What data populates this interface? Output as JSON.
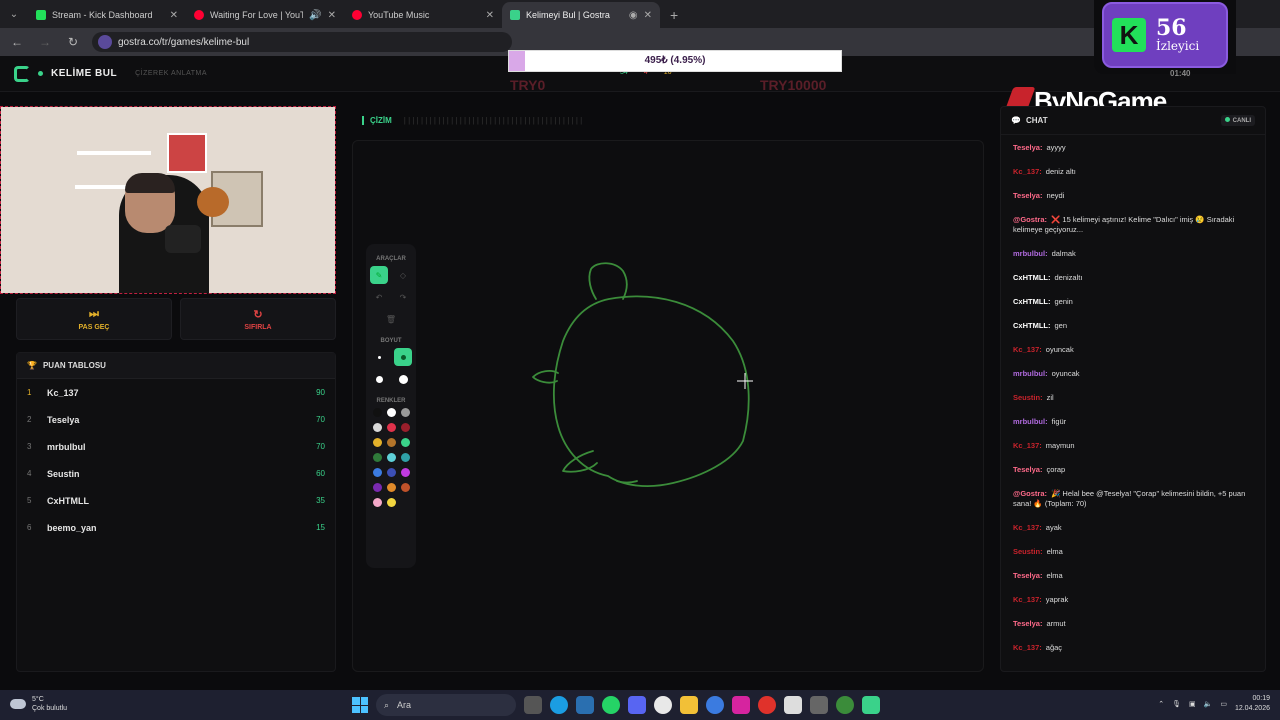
{
  "browser": {
    "tabs": [
      {
        "title": "Stream - Kick Dashboard",
        "color": "#22e05a"
      },
      {
        "title": "Waiting For Love | YouTube Mu",
        "color": "#ff0033"
      },
      {
        "title": "YouTube Music",
        "color": "#ff0033"
      },
      {
        "title": "Kelimeyi Bul | Gostra",
        "color": "#3ad28a"
      }
    ],
    "url": "gostra.co/tr/games/kelime-bul"
  },
  "site": {
    "name": "KELİME BUL",
    "subtitle": "ÇİZEREK ANLATMA"
  },
  "donation": {
    "progress_text": "495₺ (4.95%)",
    "progress_fraction": 0.0495,
    "left_label": "TRY0",
    "right_label": "TRY10000"
  },
  "stats": {
    "a": "34",
    "b": "4",
    "c": "16",
    "timer": "01:40"
  },
  "kick": {
    "letter": "K",
    "count": "56",
    "label": "İzleyici"
  },
  "sponsor": "ByNoGame",
  "controls": {
    "skip": "PAS GEÇ",
    "reset": "SIFIRLA"
  },
  "leaderboard": {
    "title": "PUAN TABLOSU",
    "rows": [
      {
        "rank": "1",
        "name": "Kc_137",
        "points": "90"
      },
      {
        "rank": "2",
        "name": "Teselya",
        "points": "70"
      },
      {
        "rank": "3",
        "name": "mrbulbul",
        "points": "70"
      },
      {
        "rank": "4",
        "name": "Seustin",
        "points": "60"
      },
      {
        "rank": "5",
        "name": "CxHTMLL",
        "points": "35"
      },
      {
        "rank": "6",
        "name": "beemo_yan",
        "points": "15"
      }
    ]
  },
  "canvas": {
    "title": "ÇİZİM"
  },
  "tools": {
    "tools_label": "ARAÇLAR",
    "size_label": "BOYUT",
    "colors_label": "RENKLER",
    "palette": [
      "#111111",
      "#ffffff",
      "#9a9a9a",
      "#d9d9d9",
      "#e0324b",
      "#9a1f2b",
      "#e2b02a",
      "#b3742a",
      "#3ad28a",
      "#2f7a3a",
      "#5fd0d8",
      "#2fa0a8",
      "#3b7be0",
      "#3c4fb5",
      "#c03ae0",
      "#7a2ab0",
      "#e08a2a",
      "#c0522a",
      "#f4a8c8",
      "#f2d640"
    ]
  },
  "chat": {
    "title": "CHAT",
    "live_label": "CANLI",
    "messages": [
      {
        "user": "Teselya:",
        "text": "ayyyy",
        "color": "#ff6a8a"
      },
      {
        "user": "Kc_137:",
        "text": "deniz altı",
        "color": "#c8232c"
      },
      {
        "user": "Teselya:",
        "text": "neydi",
        "color": "#ff6a8a"
      },
      {
        "user": "@Gostra:",
        "text": "❌ 15 kelimeyi aştınız! Kelime \"Dalıcı\" imiş 😢 Sıradaki kelimeye geçiyoruz...",
        "color": "#ff6a8a"
      },
      {
        "user": "mrbulbul:",
        "text": "dalmak",
        "color": "#b06adf"
      },
      {
        "user": "CxHTMLL:",
        "text": "denizaltı",
        "color": "#ffffff"
      },
      {
        "user": "CxHTMLL:",
        "text": "genin",
        "color": "#ffffff"
      },
      {
        "user": "CxHTMLL:",
        "text": "gen",
        "color": "#ffffff"
      },
      {
        "user": "Kc_137:",
        "text": "oyuncak",
        "color": "#c8232c"
      },
      {
        "user": "mrbulbul:",
        "text": "oyuncak",
        "color": "#b06adf"
      },
      {
        "user": "Seustin:",
        "text": "zil",
        "color": "#c8232c"
      },
      {
        "user": "mrbulbul:",
        "text": "figür",
        "color": "#b06adf"
      },
      {
        "user": "Kc_137:",
        "text": "maymun",
        "color": "#c8232c"
      },
      {
        "user": "Teselya:",
        "text": "çorap",
        "color": "#ff6a8a"
      },
      {
        "user": "@Gostra:",
        "text": "🎉 Helal bee @Teselya! \"Çorap\" kelimesini bildin, +5 puan sana! 🔥 (Toplam: 70)",
        "color": "#ff6a8a"
      },
      {
        "user": "Kc_137:",
        "text": "ayak",
        "color": "#c8232c"
      },
      {
        "user": "Seustin:",
        "text": "elma",
        "color": "#c8232c"
      },
      {
        "user": "Teselya:",
        "text": "elma",
        "color": "#ff6a8a"
      },
      {
        "user": "Kc_137:",
        "text": "yaprak",
        "color": "#c8232c"
      },
      {
        "user": "Teselya:",
        "text": "armut",
        "color": "#ff6a8a"
      },
      {
        "user": "Kc_137:",
        "text": "ağaç",
        "color": "#c8232c"
      }
    ]
  },
  "taskbar": {
    "temperature": "5°C",
    "weather": "Çok bulutlu",
    "search": "Ara",
    "time": "00:19",
    "date": "12.04.2026"
  }
}
